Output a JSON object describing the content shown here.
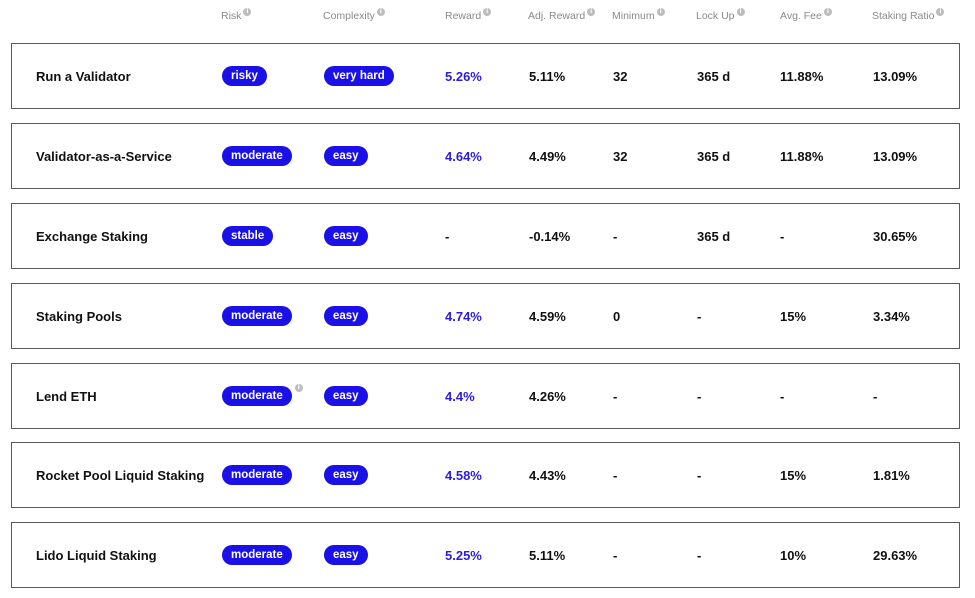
{
  "columns": [
    {
      "key": "risk",
      "label": "Risk"
    },
    {
      "key": "complexity",
      "label": "Complexity"
    },
    {
      "key": "reward",
      "label": "Reward"
    },
    {
      "key": "adj_reward",
      "label": "Adj. Reward"
    },
    {
      "key": "minimum",
      "label": "Minimum"
    },
    {
      "key": "lock_up",
      "label": "Lock Up"
    },
    {
      "key": "avg_fee",
      "label": "Avg. Fee"
    },
    {
      "key": "staking_ratio",
      "label": "Staking Ratio"
    }
  ],
  "info_glyph": "i",
  "rows": [
    {
      "name": "Run a Validator",
      "risk": "risky",
      "complexity": "very hard",
      "reward": "5.26%",
      "adj_reward": "5.11%",
      "minimum": "32",
      "lock_up": "365 d",
      "avg_fee": "11.88%",
      "staking_ratio": "13.09%"
    },
    {
      "name": "Validator-as-a-Service",
      "risk": "moderate",
      "complexity": "easy",
      "reward": "4.64%",
      "adj_reward": "4.49%",
      "minimum": "32",
      "lock_up": "365 d",
      "avg_fee": "11.88%",
      "staking_ratio": "13.09%"
    },
    {
      "name": "Exchange Staking",
      "risk": "stable",
      "complexity": "easy",
      "reward": "-",
      "adj_reward": "-0.14%",
      "minimum": "-",
      "lock_up": "365 d",
      "avg_fee": "-",
      "staking_ratio": "30.65%"
    },
    {
      "name": "Staking Pools",
      "risk": "moderate",
      "complexity": "easy",
      "reward": "4.74%",
      "adj_reward": "4.59%",
      "minimum": "0",
      "lock_up": "-",
      "avg_fee": "15%",
      "staking_ratio": "3.34%"
    },
    {
      "name": "Lend ETH",
      "risk": "moderate",
      "complexity": "easy",
      "reward": "4.4%",
      "adj_reward": "4.26%",
      "minimum": "-",
      "lock_up": "-",
      "avg_fee": "-",
      "staking_ratio": "-"
    },
    {
      "name": "Rocket Pool Liquid Staking",
      "risk": "moderate",
      "complexity": "easy",
      "reward": "4.58%",
      "adj_reward": "4.43%",
      "minimum": "-",
      "lock_up": "-",
      "avg_fee": "15%",
      "staking_ratio": "1.81%"
    },
    {
      "name": "Lido Liquid Staking",
      "risk": "moderate",
      "complexity": "easy",
      "reward": "5.25%",
      "adj_reward": "5.11%",
      "minimum": "-",
      "lock_up": "-",
      "avg_fee": "10%",
      "staking_ratio": "29.63%"
    }
  ],
  "colors": {
    "accent": "#1a10e8",
    "reward_text": "#2a1de0",
    "header_text": "#8a8a8a"
  }
}
